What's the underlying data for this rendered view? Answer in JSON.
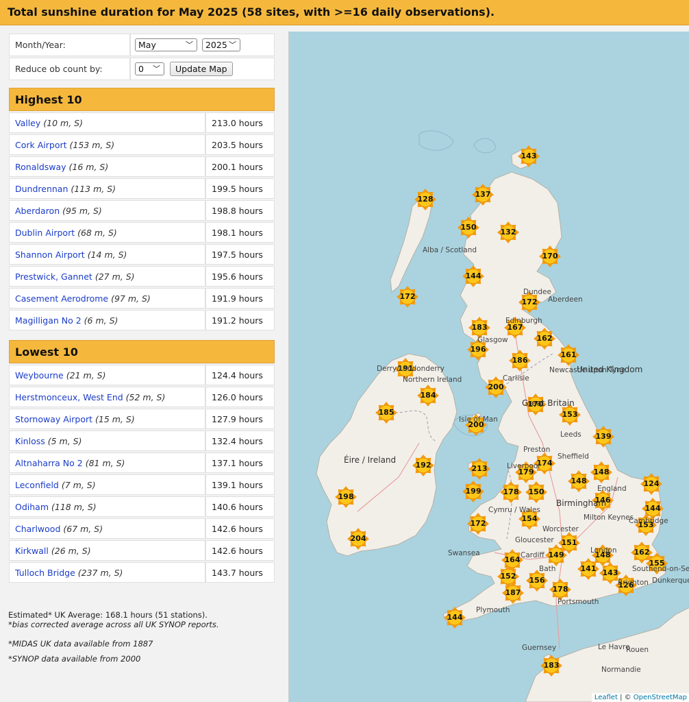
{
  "title": "Total sunshine duration for May 2025 (58 sites, with >=16 daily observations).",
  "form": {
    "month_year_label": "Month/Year:",
    "month_value": "May",
    "year_value": "2025",
    "reduce_label": "Reduce ob count by:",
    "reduce_value": "0",
    "update_button": "Update Map"
  },
  "highest": {
    "heading": "Highest 10",
    "rows": [
      {
        "name": "Valley",
        "meta": "(10 m, S)",
        "value": "213.0 hours"
      },
      {
        "name": "Cork Airport",
        "meta": "(153 m, S)",
        "value": "203.5 hours"
      },
      {
        "name": "Ronaldsway",
        "meta": "(16 m, S)",
        "value": "200.1 hours"
      },
      {
        "name": "Dundrennan",
        "meta": "(113 m, S)",
        "value": "199.5 hours"
      },
      {
        "name": "Aberdaron",
        "meta": "(95 m, S)",
        "value": "198.8 hours"
      },
      {
        "name": "Dublin Airport",
        "meta": "(68 m, S)",
        "value": "198.1 hours"
      },
      {
        "name": "Shannon Airport",
        "meta": "(14 m, S)",
        "value": "197.5 hours"
      },
      {
        "name": "Prestwick, Gannet",
        "meta": "(27 m, S)",
        "value": "195.6 hours"
      },
      {
        "name": "Casement Aerodrome",
        "meta": "(97 m, S)",
        "value": "191.9 hours"
      },
      {
        "name": "Magilligan No 2",
        "meta": "(6 m, S)",
        "value": "191.2 hours"
      }
    ]
  },
  "lowest": {
    "heading": "Lowest 10",
    "rows": [
      {
        "name": "Weybourne",
        "meta": "(21 m, S)",
        "value": "124.4 hours"
      },
      {
        "name": "Herstmonceux, West End",
        "meta": "(52 m, S)",
        "value": "126.0 hours"
      },
      {
        "name": "Stornoway Airport",
        "meta": "(15 m, S)",
        "value": "127.9 hours"
      },
      {
        "name": "Kinloss",
        "meta": "(5 m, S)",
        "value": "132.4 hours"
      },
      {
        "name": "Altnaharra No 2",
        "meta": "(81 m, S)",
        "value": "137.1 hours"
      },
      {
        "name": "Leconfield",
        "meta": "(7 m, S)",
        "value": "139.1 hours"
      },
      {
        "name": "Odiham",
        "meta": "(118 m, S)",
        "value": "140.6 hours"
      },
      {
        "name": "Charlwood",
        "meta": "(67 m, S)",
        "value": "142.6 hours"
      },
      {
        "name": "Kirkwall",
        "meta": "(26 m, S)",
        "value": "142.6 hours"
      },
      {
        "name": "Tulloch Bridge",
        "meta": "(237 m, S)",
        "value": "143.7 hours"
      }
    ]
  },
  "notes": {
    "average": "Estimated* UK Average: 168.1 hours (51 stations).",
    "bias": "*bias corrected average across all UK SYNOP reports.",
    "midas": "*MIDAS UK data available from 1887",
    "synop": "*SYNOP data available from 2000"
  },
  "map": {
    "markers": [
      "143",
      "137",
      "128",
      "150",
      "132",
      "170",
      "144",
      "172",
      "172",
      "183",
      "167",
      "162",
      "196",
      "161",
      "186",
      "191",
      "200",
      "184",
      "185",
      "170",
      "153",
      "200",
      "139",
      "174",
      "179",
      "213",
      "192",
      "148",
      "148",
      "124",
      "178",
      "150",
      "198",
      "199",
      "146",
      "144",
      "154",
      "172",
      "153",
      "151",
      "204",
      "149",
      "148",
      "162",
      "164",
      "141",
      "143",
      "155",
      "152",
      "156",
      "126",
      "187",
      "178",
      "144",
      "183"
    ],
    "place_labels": [
      "Alba / Scotland",
      "Aberdeen",
      "Dundee",
      "Edinburgh",
      "Glasgow",
      "United Kingdom",
      "Carlisle",
      "Newcastle upon Tyne",
      "Derry/Londonderry",
      "Northern Ireland",
      "Great Britain",
      "Isle of Man",
      "Leeds",
      "Éire / Ireland",
      "Preston",
      "Sheffield",
      "Liverpool",
      "England",
      "Birmingham",
      "Cymru / Wales",
      "Milton Keynes",
      "Worcester",
      "Cambridge",
      "Gloucester",
      "London",
      "Swansea",
      "Cardiff",
      "Bath",
      "Southend-on-Sea",
      "Brighton",
      "Portsmouth",
      "Plymouth",
      "Dunkerque",
      "Guernsey",
      "Le Havre",
      "Rouen",
      "Normandie"
    ],
    "attribution_leaflet": "Leaflet",
    "attribution_sep": " | © ",
    "attribution_osm": "OpenStreetMap"
  },
  "colors": {
    "accent": "#f5b83d",
    "link": "#1a3cc7",
    "sea": "#aad3df",
    "land": "#f2efe9",
    "marker": "#f7b500"
  }
}
